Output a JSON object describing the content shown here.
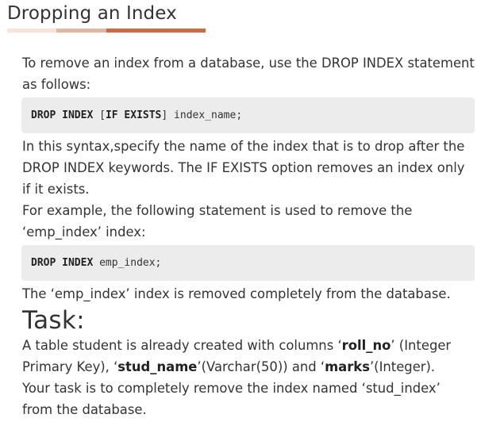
{
  "heading": {
    "title": "Dropping an Index"
  },
  "intro": {
    "text": "To remove an index from a database, use the DROP INDEX statement as follows:"
  },
  "syntax_code": {
    "kw_drop_index": "DROP INDEX",
    "bracket_open": " [",
    "kw_if_exists": "IF EXISTS",
    "bracket_close": "] ",
    "rest": "index_name;"
  },
  "explanation": {
    "line1": "In this syntax,specify the name of the index that is to drop after the DROP INDEX keywords. The IF EXISTS option removes an index only if it exists.",
    "line2": "For example, the following statement is used to remove the ‘emp_index’ index:"
  },
  "example_code": {
    "kw_drop_index": "DROP INDEX",
    "rest": " emp_index;"
  },
  "result": {
    "text": "The ‘emp_index’ index is removed completely from the database."
  },
  "task": {
    "heading": "Task:",
    "p1_a": "A table student is already created with columns ‘",
    "p1_col1": "roll_no",
    "p1_b": "’ (Integer Primary Key), ‘",
    "p1_col2": "stud_name",
    "p1_c": "’(Varchar(50)) and ‘",
    "p1_col3": "marks",
    "p1_d": "’(Integer).",
    "p2": "Your task is to completely remove the index named ‘stud_index’ from the database."
  },
  "colors": {
    "underline_light": "#f9e3d8",
    "underline_mid": "#e0b79e",
    "underline_accent": "#d3683e",
    "code_background": "#ececec",
    "text": "#333333"
  }
}
